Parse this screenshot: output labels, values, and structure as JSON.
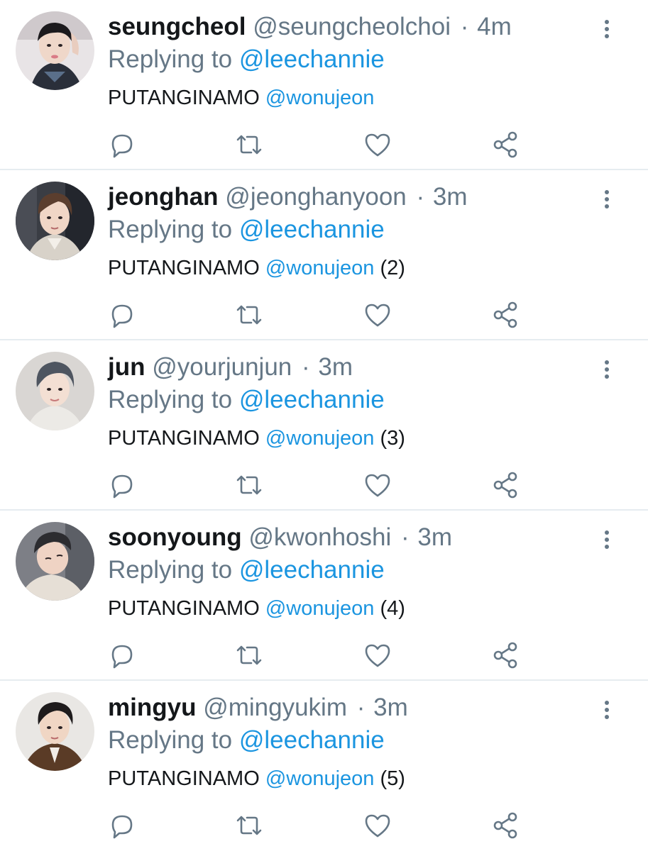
{
  "reply_prefix": "Replying to",
  "tweets": [
    {
      "display_name": "seungcheol",
      "handle": "@seungcheolchoi",
      "separator": "·",
      "time": "4m",
      "replying_to": "@leechannie",
      "text": "PUTANGINAMO",
      "mention": "@wonujeon",
      "suffix": ""
    },
    {
      "display_name": "jeonghan",
      "handle": "@jeonghanyoon",
      "separator": "·",
      "time": "3m",
      "replying_to": "@leechannie",
      "text": "PUTANGINAMO",
      "mention": "@wonujeon",
      "suffix": "(2)"
    },
    {
      "display_name": "jun",
      "handle": "@yourjunjun",
      "separator": "·",
      "time": "3m",
      "replying_to": "@leechannie",
      "text": "PUTANGINAMO",
      "mention": "@wonujeon",
      "suffix": "(3)"
    },
    {
      "display_name": "soonyoung",
      "handle": "@kwonhoshi",
      "separator": "·",
      "time": "3m",
      "replying_to": "@leechannie",
      "text": "PUTANGINAMO",
      "mention": "@wonujeon",
      "suffix": "(4)"
    },
    {
      "display_name": "mingyu",
      "handle": "@mingyukim",
      "separator": "·",
      "time": "3m",
      "replying_to": "@leechannie",
      "text": "PUTANGINAMO",
      "mention": "@wonujeon",
      "suffix": "(5)"
    }
  ],
  "icons": {
    "reply": "reply-icon",
    "retweet": "retweet-icon",
    "like": "like-icon",
    "share": "share-icon",
    "more": "more-options-icon"
  },
  "colors": {
    "text_primary": "#14171a",
    "text_secondary": "#657786",
    "link": "#1b95e0",
    "divider": "#e6ecf0",
    "icon": "#657786"
  }
}
